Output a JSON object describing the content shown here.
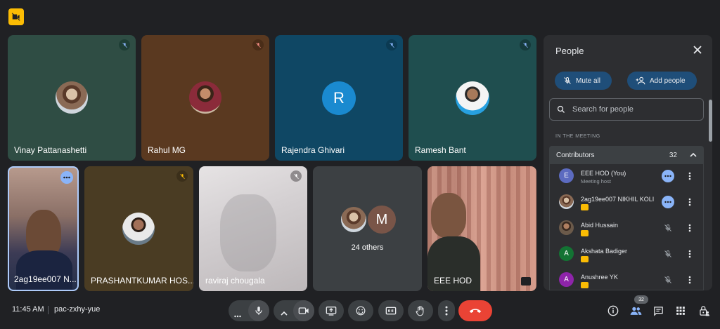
{
  "tiles_top": [
    {
      "name": "Vinay Pattanashetti",
      "color": "#2f4d44"
    },
    {
      "name": "Rahul MG",
      "color": "#5a3920"
    },
    {
      "name": "Rajendra Ghivari",
      "initial": "R",
      "color": "#0f4764"
    },
    {
      "name": "Ramesh Bant",
      "color": "#1f4e4f"
    }
  ],
  "tiles_bottom": [
    {
      "name": "2ag19ee007 N..."
    },
    {
      "name": "PRASHANTKUMAR HOS..."
    },
    {
      "name": "raviraj chougala"
    },
    {
      "others_label": "24 others",
      "initial": "M"
    },
    {
      "name": "EEE HOD"
    }
  ],
  "panel": {
    "title": "People",
    "mute_all": "Mute all",
    "add_people": "Add people",
    "search_placeholder": "Search for people",
    "section_label": "IN THE MEETING",
    "contributors_label": "Contributors",
    "contributors_count": "32",
    "people": [
      {
        "name": "EEE HOD (You)",
        "sub": "Meeting host",
        "initial": "E",
        "color": "#5c6bc0"
      },
      {
        "name": "2ag19ee007 NIKHIL KOLI",
        "sub": ""
      },
      {
        "name": "Abid Hussain",
        "sub": ""
      },
      {
        "name": "Akshata Badiger",
        "sub": "",
        "initial": "A",
        "color": "#137333"
      },
      {
        "name": "Anushree YK",
        "sub": "",
        "initial": "A",
        "color": "#8e24aa"
      }
    ]
  },
  "bottom": {
    "time": "11:45 AM",
    "meeting_code": "pac-zxhy-yue",
    "people_count": "32"
  }
}
